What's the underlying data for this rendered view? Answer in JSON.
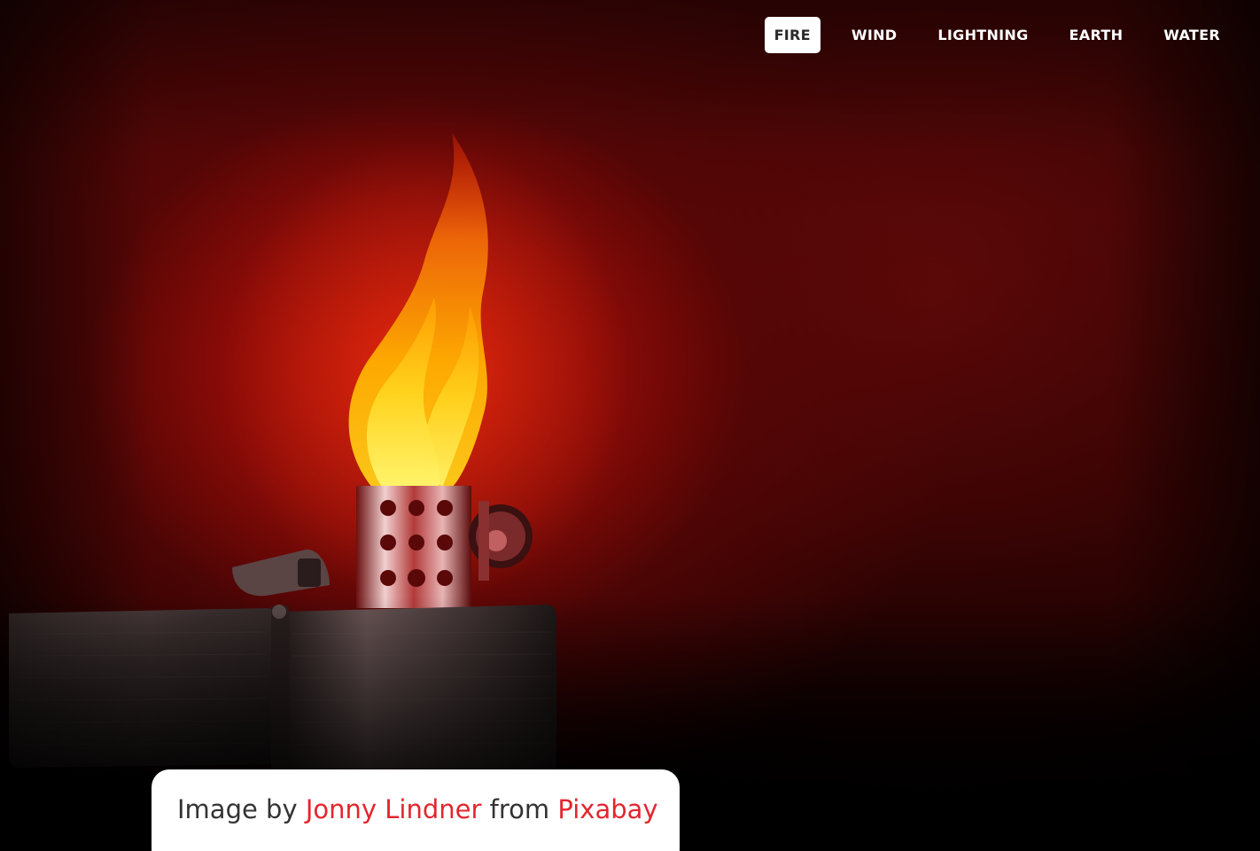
{
  "nav": {
    "items": [
      {
        "label": "FIRE",
        "active": true
      },
      {
        "label": "WIND",
        "active": false
      },
      {
        "label": "LIGHTNING",
        "active": false
      },
      {
        "label": "EARTH",
        "active": false
      },
      {
        "label": "WATER",
        "active": false
      }
    ]
  },
  "credit": {
    "prefix": "Image by ",
    "author": "Jonny Lindner",
    "middle": " from ",
    "source": "Pixabay"
  },
  "colors": {
    "accent_link": "#e3262e",
    "nav_active_bg": "#ffffff",
    "nav_text": "#ffffff",
    "background_red": "#a50e0b"
  },
  "hero": {
    "subject": "lighter-flame-image"
  }
}
